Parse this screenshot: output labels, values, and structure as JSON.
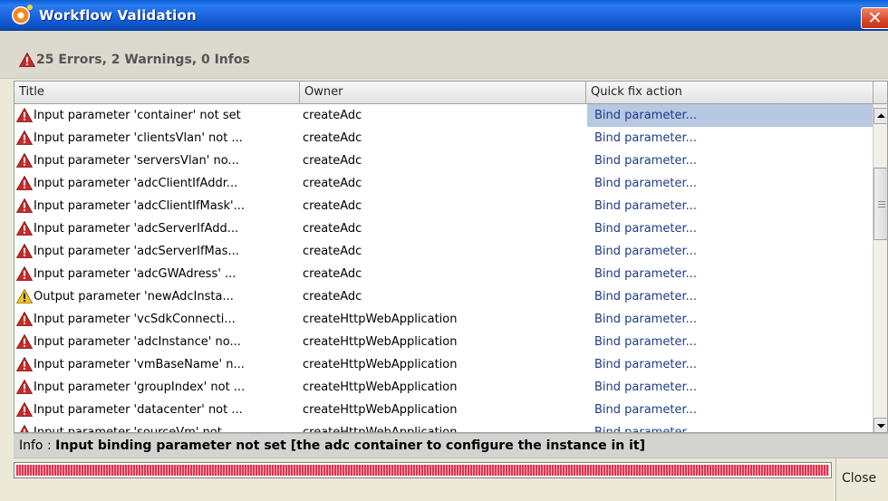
{
  "window": {
    "title": "Workflow Validation",
    "close_glyph": "✕"
  },
  "summary": {
    "text": "25 Errors, 2 Warnings, 0 Infos"
  },
  "table": {
    "columns": [
      "Title",
      "Owner",
      "Quick fix action"
    ],
    "rows": [
      {
        "severity": "error",
        "title": "Input parameter 'container' not set",
        "owner": "createAdc",
        "action": "Bind parameter..."
      },
      {
        "severity": "error",
        "title": "Input parameter 'clientsVlan' not ...",
        "owner": "createAdc",
        "action": "Bind parameter..."
      },
      {
        "severity": "error",
        "title": "Input parameter 'serversVlan' no...",
        "owner": "createAdc",
        "action": "Bind parameter..."
      },
      {
        "severity": "error",
        "title": "Input parameter 'adcClientIfAddr...",
        "owner": "createAdc",
        "action": "Bind parameter..."
      },
      {
        "severity": "error",
        "title": "Input parameter 'adcClientIfMask'...",
        "owner": "createAdc",
        "action": "Bind parameter..."
      },
      {
        "severity": "error",
        "title": "Input parameter 'adcServerIfAdd...",
        "owner": "createAdc",
        "action": "Bind parameter..."
      },
      {
        "severity": "error",
        "title": "Input parameter 'adcServerIfMas...",
        "owner": "createAdc",
        "action": "Bind parameter..."
      },
      {
        "severity": "error",
        "title": "Input parameter 'adcGWAdress' ...",
        "owner": "createAdc",
        "action": "Bind parameter..."
      },
      {
        "severity": "warning",
        "title": "Output parameter 'newAdcInsta...",
        "owner": "createAdc",
        "action": "Bind parameter..."
      },
      {
        "severity": "error",
        "title": "Input parameter 'vcSdkConnecti...",
        "owner": "createHttpWebApplication",
        "action": "Bind parameter..."
      },
      {
        "severity": "error",
        "title": "Input parameter 'adcInstance' no...",
        "owner": "createHttpWebApplication",
        "action": "Bind parameter..."
      },
      {
        "severity": "error",
        "title": "Input parameter 'vmBaseName' n...",
        "owner": "createHttpWebApplication",
        "action": "Bind parameter..."
      },
      {
        "severity": "error",
        "title": "Input parameter 'groupIndex' not ...",
        "owner": "createHttpWebApplication",
        "action": "Bind parameter..."
      },
      {
        "severity": "error",
        "title": "Input parameter 'datacenter' not ...",
        "owner": "createHttpWebApplication",
        "action": "Bind parameter..."
      },
      {
        "severity": "error",
        "title": "Input parameter 'sourceVm' not ...",
        "owner": "createHttpWebApplication",
        "action": "Bind parameter..."
      }
    ],
    "selected_row": 0
  },
  "info": {
    "label": "Info : ",
    "message": "Input binding parameter not set [the adc container to configure the instance in it]"
  },
  "progress": {
    "value": 1.0,
    "color": "#e0334f"
  },
  "buttons": {
    "close_label": "Close"
  },
  "icons": {
    "error": "error-triangle-icon",
    "warning": "warning-triangle-icon"
  }
}
